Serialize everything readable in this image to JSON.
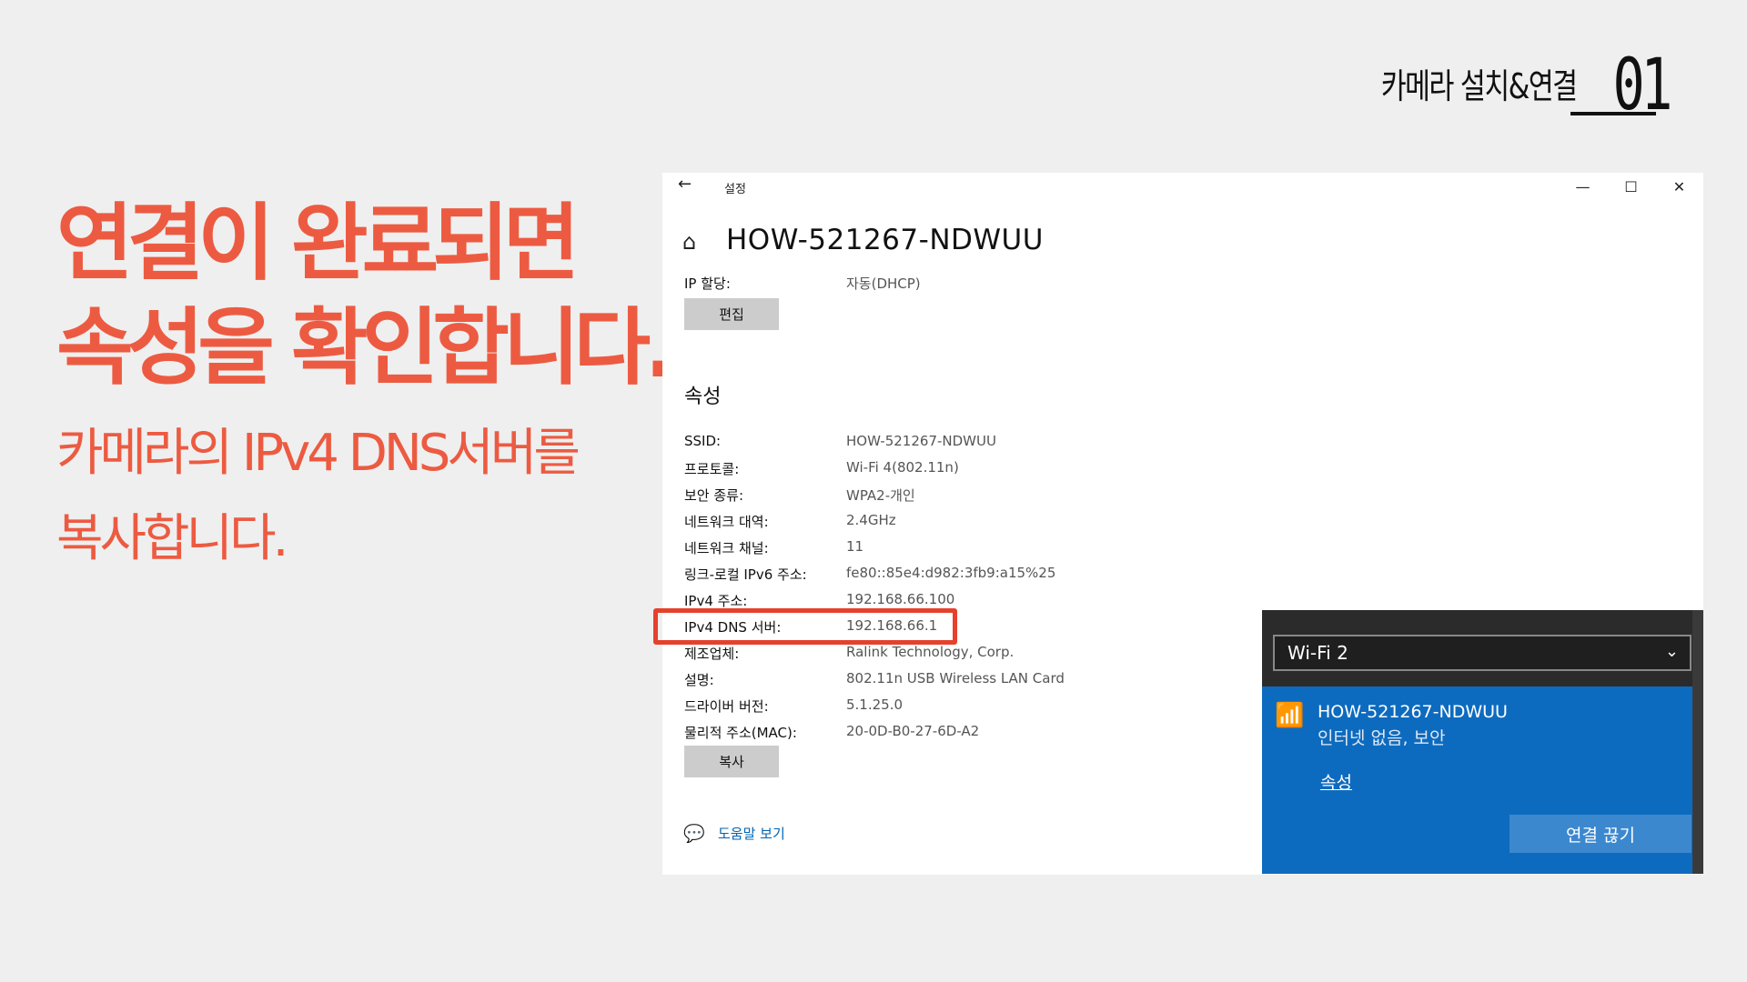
{
  "chapter": {
    "title": "카메라 설치&연결",
    "number": "01"
  },
  "headline": {
    "line1": "연결이 완료되면",
    "line2": "속성을 확인합니다."
  },
  "subline": {
    "line1": "카메라의 IPv4 DNS서버를",
    "line2": "복사합니다."
  },
  "window": {
    "title": "설정",
    "network_name": "HOW-521267-NDWUU",
    "ip_assignment": {
      "label": "IP 할당:",
      "value": "자동(DHCP)"
    },
    "edit_button": "편집",
    "section_title": "속성",
    "properties": [
      {
        "label": "SSID:",
        "value": "HOW-521267-NDWUU"
      },
      {
        "label": "프로토콜:",
        "value": "Wi-Fi 4(802.11n)"
      },
      {
        "label": "보안 종류:",
        "value": "WPA2-개인"
      },
      {
        "label": "네트워크 대역:",
        "value": "2.4GHz"
      },
      {
        "label": "네트워크 채널:",
        "value": "11"
      },
      {
        "label": "링크-로컬 IPv6 주소:",
        "value": "fe80::85e4:d982:3fb9:a15%25"
      },
      {
        "label": "IPv4 주소:",
        "value": "192.168.66.100"
      },
      {
        "label": "IPv4 DNS 서버:",
        "value": "192.168.66.1"
      },
      {
        "label": "제조업체:",
        "value": "Ralink Technology, Corp."
      },
      {
        "label": "설명:",
        "value": "802.11n USB Wireless LAN Card"
      },
      {
        "label": "드라이버 버전:",
        "value": "5.1.25.0"
      },
      {
        "label": "물리적 주소(MAC):",
        "value": "20-0D-B0-27-6D-A2"
      }
    ],
    "copy_button": "복사",
    "help_link": "도움말 보기"
  },
  "flyout": {
    "adapter": "Wi-Fi 2",
    "network_name": "HOW-521267-NDWUU",
    "network_status": "인터넷 없음, 보안",
    "properties_link": "속성",
    "disconnect_button": "연결 끊기"
  }
}
